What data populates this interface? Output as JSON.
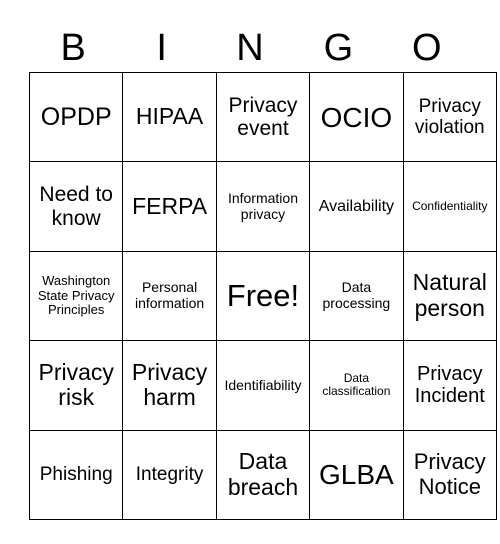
{
  "header": [
    "B",
    "I",
    "N",
    "G",
    "O"
  ],
  "cells": [
    [
      "OPDP",
      "HIPAA",
      "Privacy event",
      "OCIO",
      "Privacy violation"
    ],
    [
      "Need to know",
      "FERPA",
      "Information privacy",
      "Availability",
      "Confidentiality"
    ],
    [
      "Washington State Privacy Principles",
      "Personal information",
      "Free!",
      "Data processing",
      "Natural person"
    ],
    [
      "Privacy risk",
      "Privacy harm",
      "Identifiability",
      "Data classification",
      "Privacy Incident"
    ],
    [
      "Phishing",
      "Integrity",
      "Data breach",
      "GLBA",
      "Privacy Notice"
    ]
  ]
}
